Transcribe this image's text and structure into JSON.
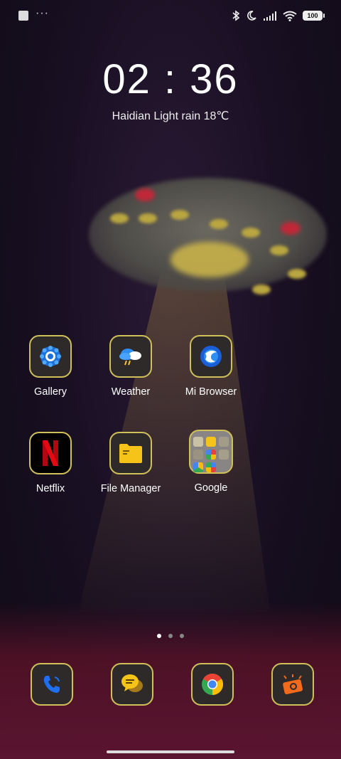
{
  "status_bar": {
    "notification_icons": [
      "app-notification-icon",
      "more-dots-icon"
    ],
    "system_icons": [
      "bluetooth-icon",
      "moon-icon",
      "signal-icon",
      "wifi-icon"
    ],
    "battery": "100"
  },
  "clock": {
    "time": "02 : 36",
    "weather": "Haidian Light rain 18℃"
  },
  "apps": {
    "row1": [
      {
        "label": "Gallery",
        "icon": "gallery-icon"
      },
      {
        "label": "Weather",
        "icon": "weather-icon"
      },
      {
        "label": "Mi Browser",
        "icon": "browser-icon"
      }
    ],
    "row2": [
      {
        "label": "Netflix",
        "icon": "netflix-icon"
      },
      {
        "label": "File Manager",
        "icon": "folder-icon"
      },
      {
        "label": "Google",
        "icon": "google-folder-icon"
      }
    ]
  },
  "page_indicator": {
    "pages": 3,
    "current": 1
  },
  "dock": [
    {
      "icon": "phone-icon"
    },
    {
      "icon": "messages-icon"
    },
    {
      "icon": "chrome-icon"
    },
    {
      "icon": "camera-icon"
    }
  ],
  "colors": {
    "icon_border": "#cfc05a",
    "netflix_red": "#e50914",
    "folder_yellow": "#f6c419"
  }
}
